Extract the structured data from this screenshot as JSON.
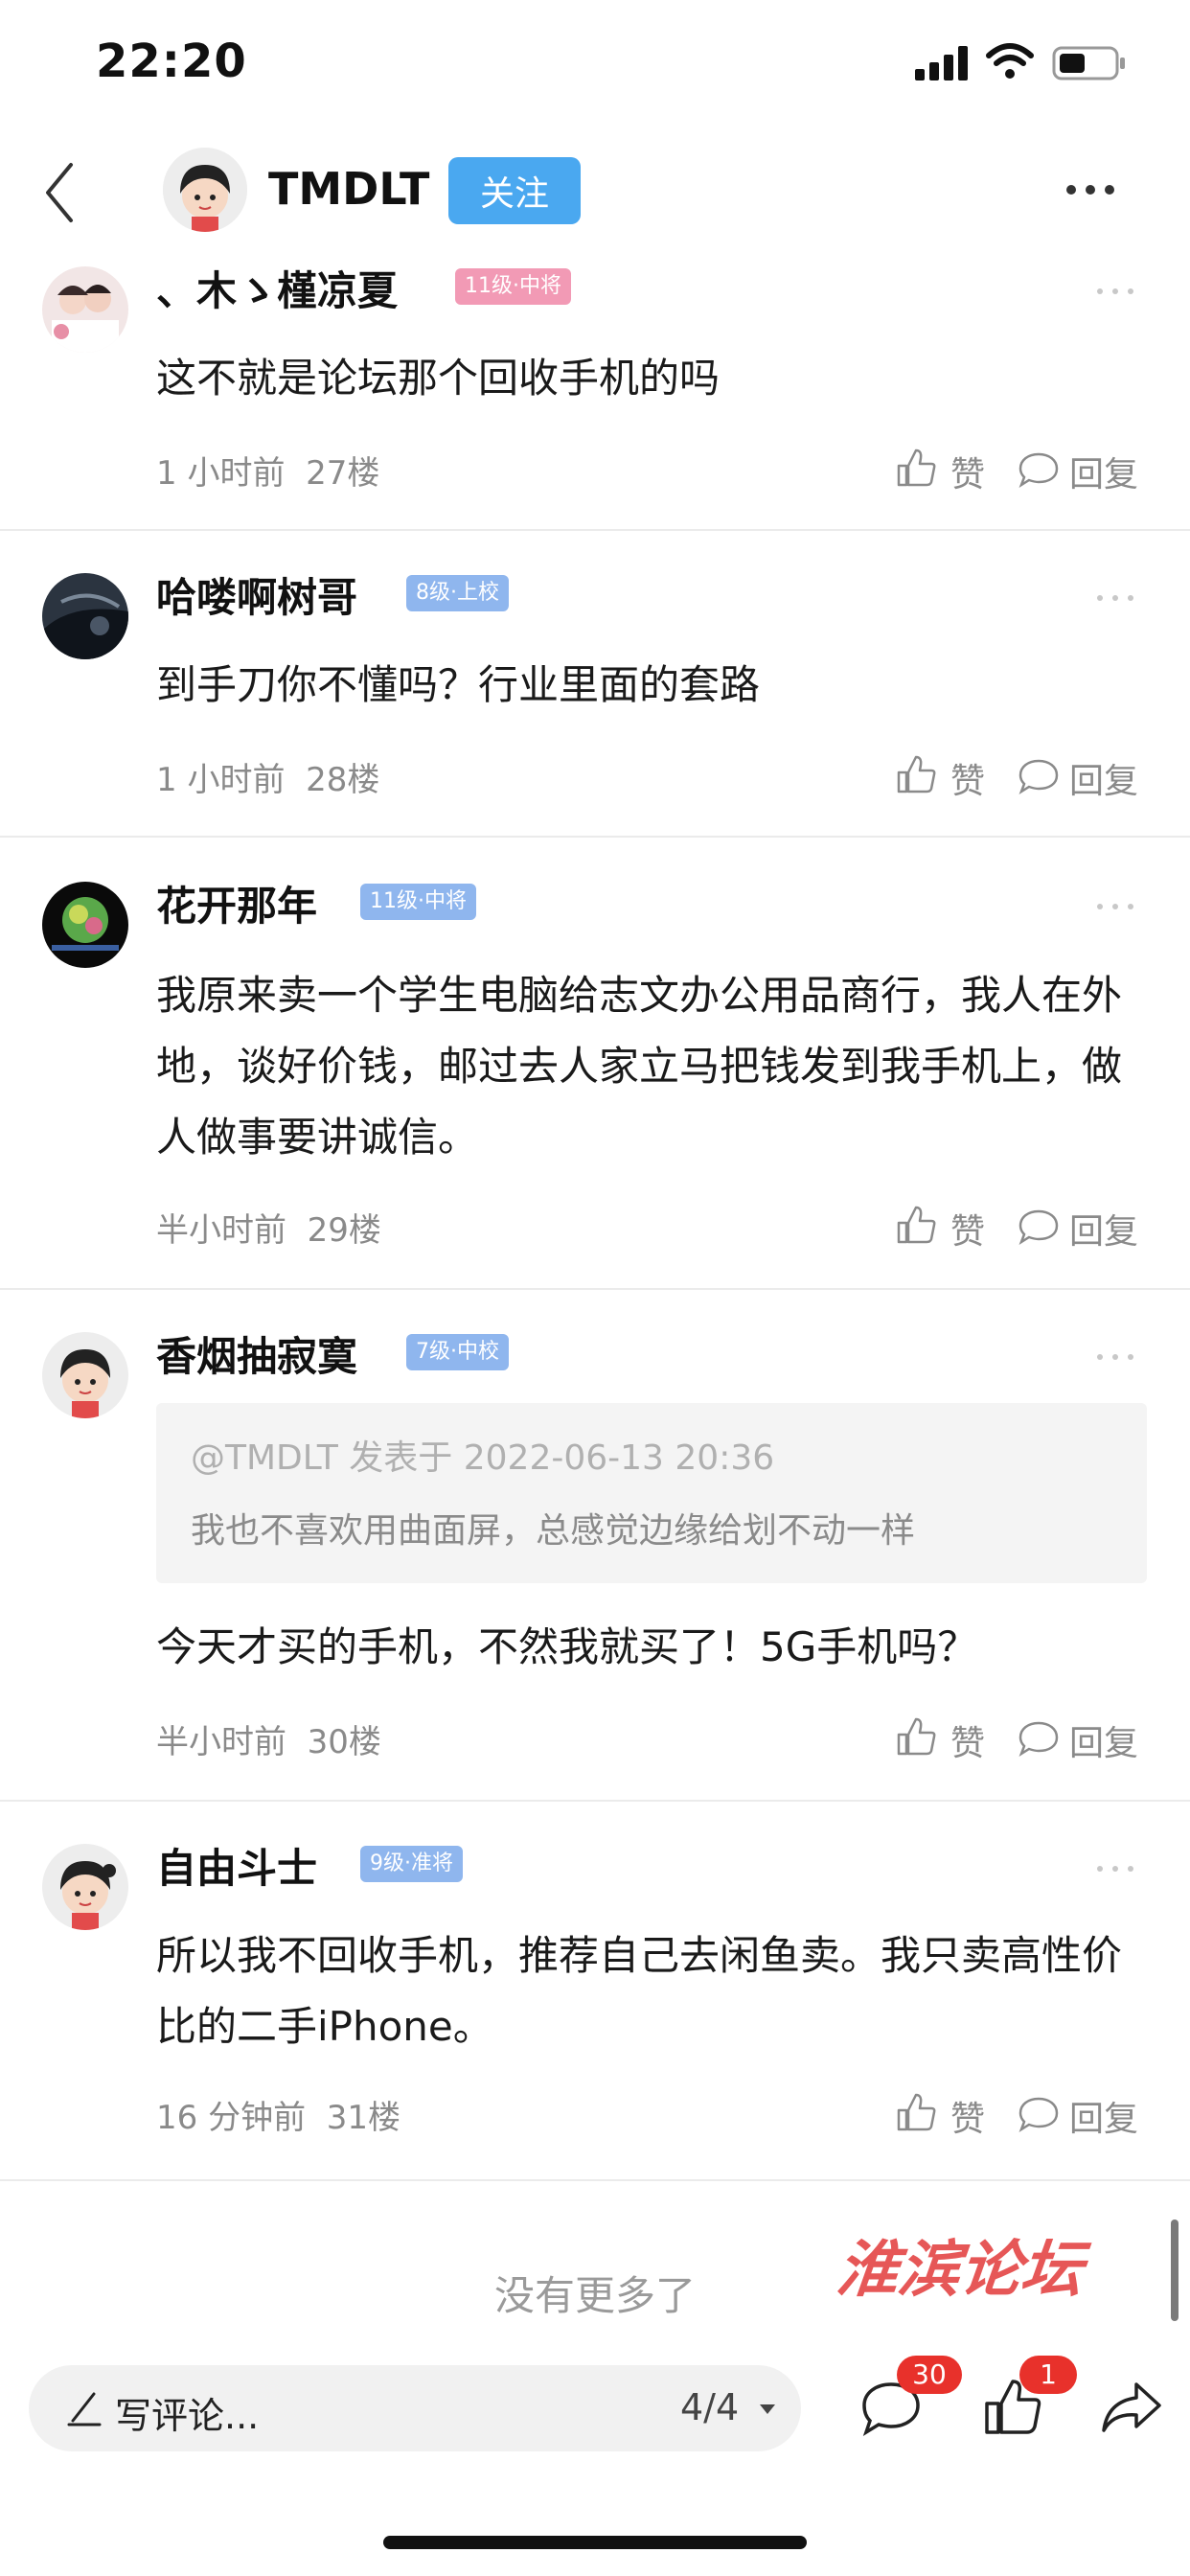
{
  "status_bar": {
    "time": "22:20"
  },
  "header": {
    "username": "TMDLT",
    "follow_label": "关注"
  },
  "comments": [
    {
      "name": "、木ゝ槿凉夏",
      "level": "11级·中将",
      "text": "这不就是论坛那个回收手机的吗",
      "time": "1 小时前",
      "floor": "27楼",
      "like_label": "赞",
      "reply_label": "回复"
    },
    {
      "name": "哈喽啊树哥",
      "level": "8级·上校",
      "text": "到手刀你不懂吗？行业里面的套路",
      "time": "1 小时前",
      "floor": "28楼",
      "like_label": "赞",
      "reply_label": "回复"
    },
    {
      "name": "花开那年",
      "level": "11级·中将",
      "text": "我原来卖一个学生电脑给志文办公用品商行，我人在外地，谈好价钱，邮过去人家立马把钱发到我手机上，做人做事要讲诚信。",
      "time": "半小时前",
      "floor": "29楼",
      "like_label": "赞",
      "reply_label": "回复"
    },
    {
      "name": "香烟抽寂寞",
      "level": "7级·中校",
      "quote_author": "@TMDLT 发表于 2022-06-13 20:36",
      "quote_text": "我也不喜欢用曲面屏，总感觉边缘给划不动一样",
      "text": "今天才买的手机，不然我就买了！5G手机吗？",
      "time": "半小时前",
      "floor": "30楼",
      "like_label": "赞",
      "reply_label": "回复"
    },
    {
      "name": "自由斗士",
      "level": "9级·准将",
      "text": "所以我不回收手机，推荐自己去闲鱼卖。我只卖高性价比的二手iPhone。",
      "time": "16 分钟前",
      "floor": "31楼",
      "like_label": "赞",
      "reply_label": "回复"
    }
  ],
  "footer_note": "没有更多了",
  "watermark": "淮滨论坛",
  "bottom_bar": {
    "write_placeholder": "写评论...",
    "page": "4/4",
    "comment_count": "30",
    "like_count": "1"
  },
  "colors": {
    "follow": "#4aa8f0",
    "badge_red": "#e8312b",
    "level_pink": "#f29ab5",
    "level_blue": "#8fb6ee"
  }
}
